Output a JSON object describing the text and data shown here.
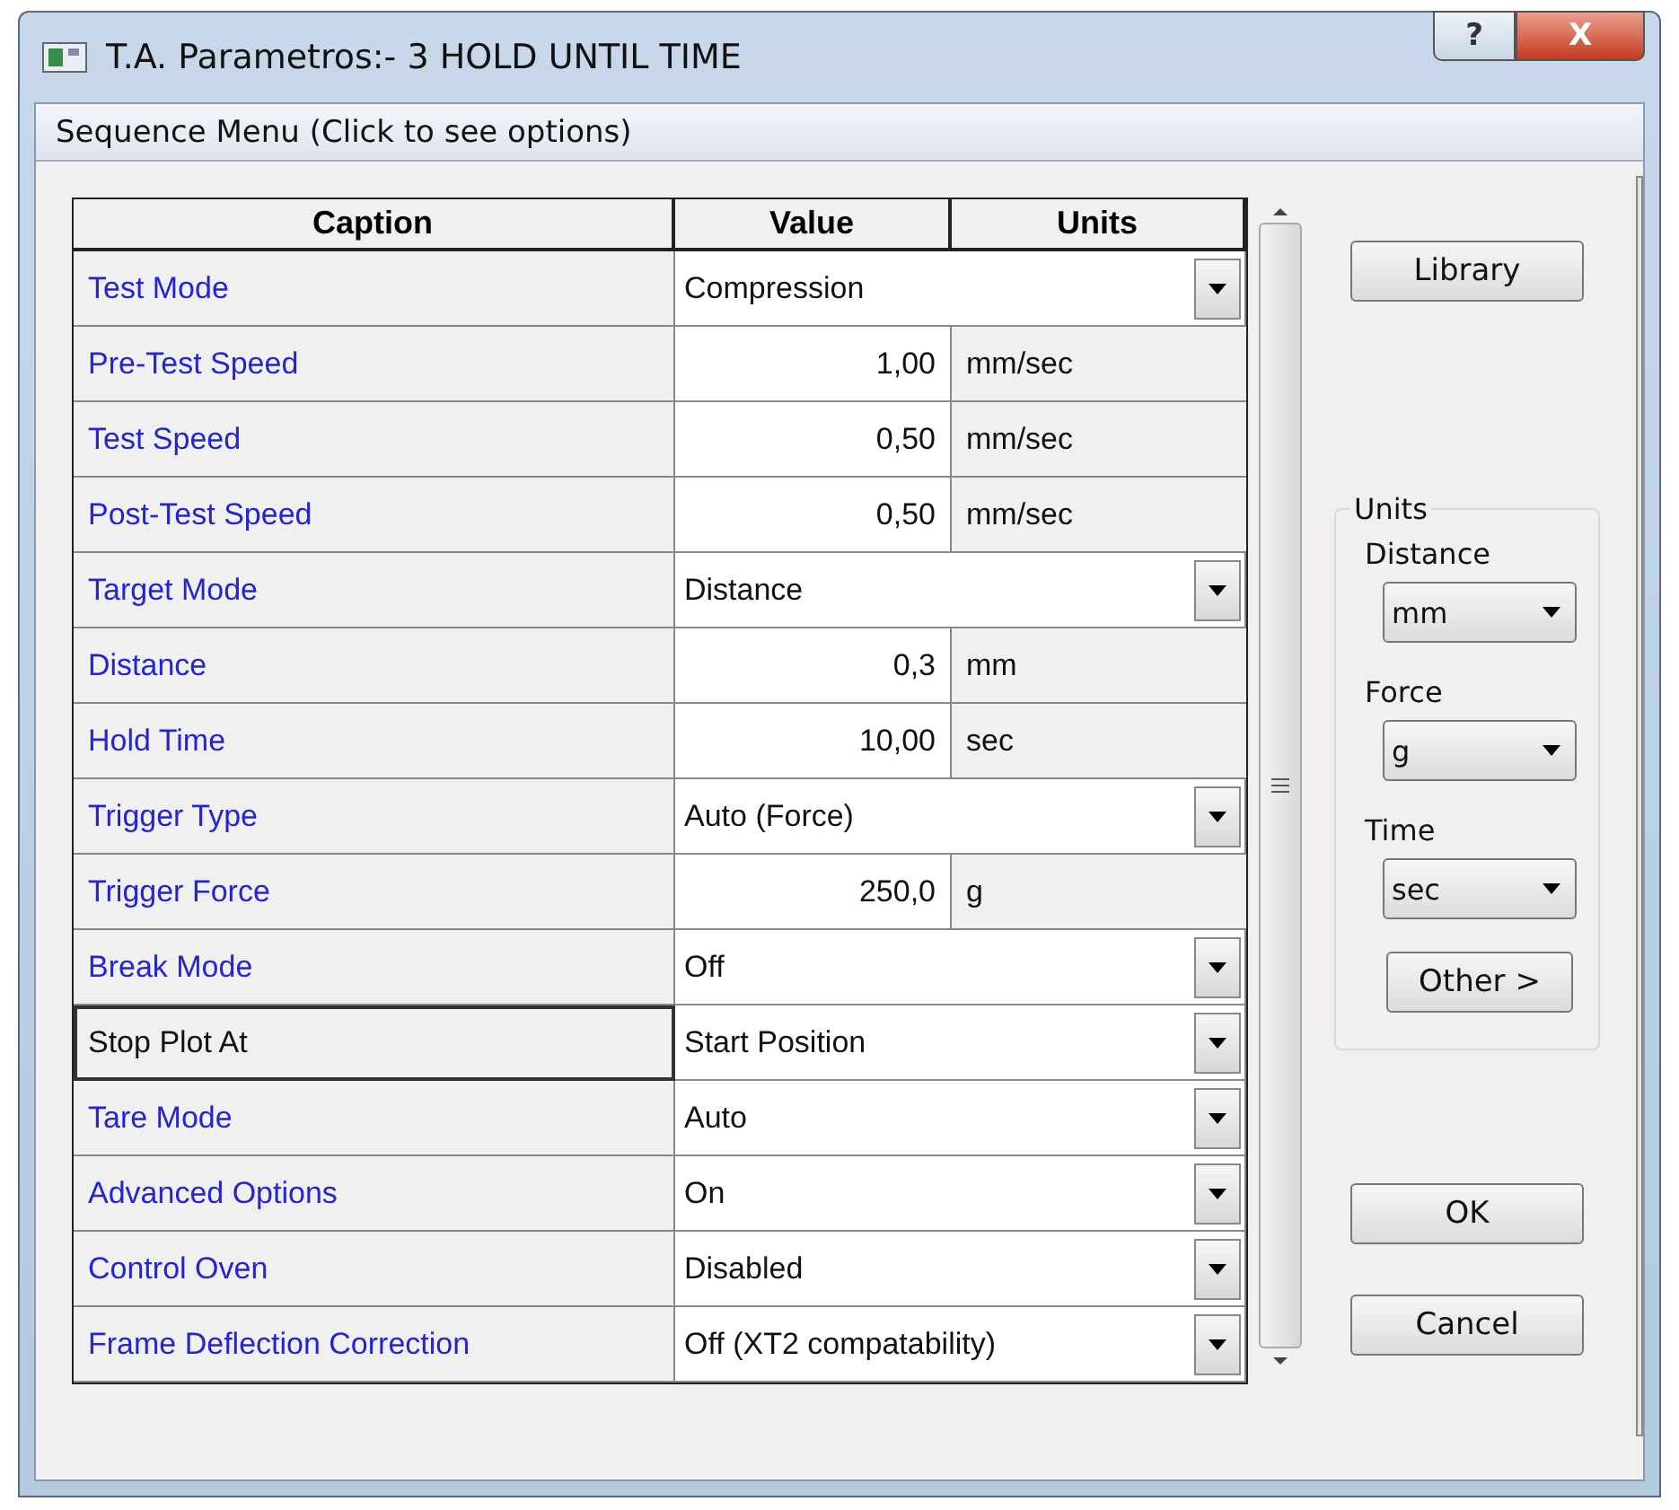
{
  "window": {
    "title": "T.A. Parametros:- 3 HOLD UNTIL TIME",
    "help_button": "?",
    "close_button": "X"
  },
  "menu": {
    "label": "Sequence Menu (Click to see options)"
  },
  "table": {
    "columns": [
      "Caption",
      "Value",
      "Units"
    ],
    "rows": [
      {
        "caption": "Test Mode",
        "kind": "dropdown",
        "value": "Compression",
        "selected": false
      },
      {
        "caption": "Pre-Test Speed",
        "kind": "number",
        "value": "1,00",
        "unit": "mm/sec",
        "selected": false
      },
      {
        "caption": "Test Speed",
        "kind": "number",
        "value": "0,50",
        "unit": "mm/sec",
        "selected": false
      },
      {
        "caption": "Post-Test Speed",
        "kind": "number",
        "value": "0,50",
        "unit": "mm/sec",
        "selected": false
      },
      {
        "caption": "Target Mode",
        "kind": "dropdown",
        "value": "Distance",
        "selected": false
      },
      {
        "caption": "Distance",
        "kind": "number",
        "value": "0,3",
        "unit": "mm",
        "selected": false
      },
      {
        "caption": "Hold Time",
        "kind": "number",
        "value": "10,00",
        "unit": "sec",
        "selected": false
      },
      {
        "caption": "Trigger Type",
        "kind": "dropdown",
        "value": "Auto (Force)",
        "selected": false
      },
      {
        "caption": "Trigger Force",
        "kind": "number",
        "value": "250,0",
        "unit": "g",
        "selected": false
      },
      {
        "caption": "Break Mode",
        "kind": "dropdown",
        "value": "Off",
        "selected": false
      },
      {
        "caption": "Stop Plot At",
        "kind": "dropdown",
        "value": "Start Position",
        "selected": true
      },
      {
        "caption": "Tare Mode",
        "kind": "dropdown",
        "value": "Auto",
        "selected": false
      },
      {
        "caption": "Advanced Options",
        "kind": "dropdown",
        "value": "On",
        "selected": false
      },
      {
        "caption": "Control Oven",
        "kind": "dropdown",
        "value": "Disabled",
        "selected": false
      },
      {
        "caption": "Frame Deflection Correction",
        "kind": "dropdown",
        "value": "Off (XT2 compatability)",
        "selected": false
      }
    ]
  },
  "library_button": "Library",
  "units": {
    "title": "Units",
    "fields": [
      {
        "label": "Distance",
        "value": "mm"
      },
      {
        "label": "Force",
        "value": "g"
      },
      {
        "label": "Time",
        "value": "sec"
      }
    ],
    "other_button": "Other  >"
  },
  "ok_button": "OK",
  "cancel_button": "Cancel"
}
